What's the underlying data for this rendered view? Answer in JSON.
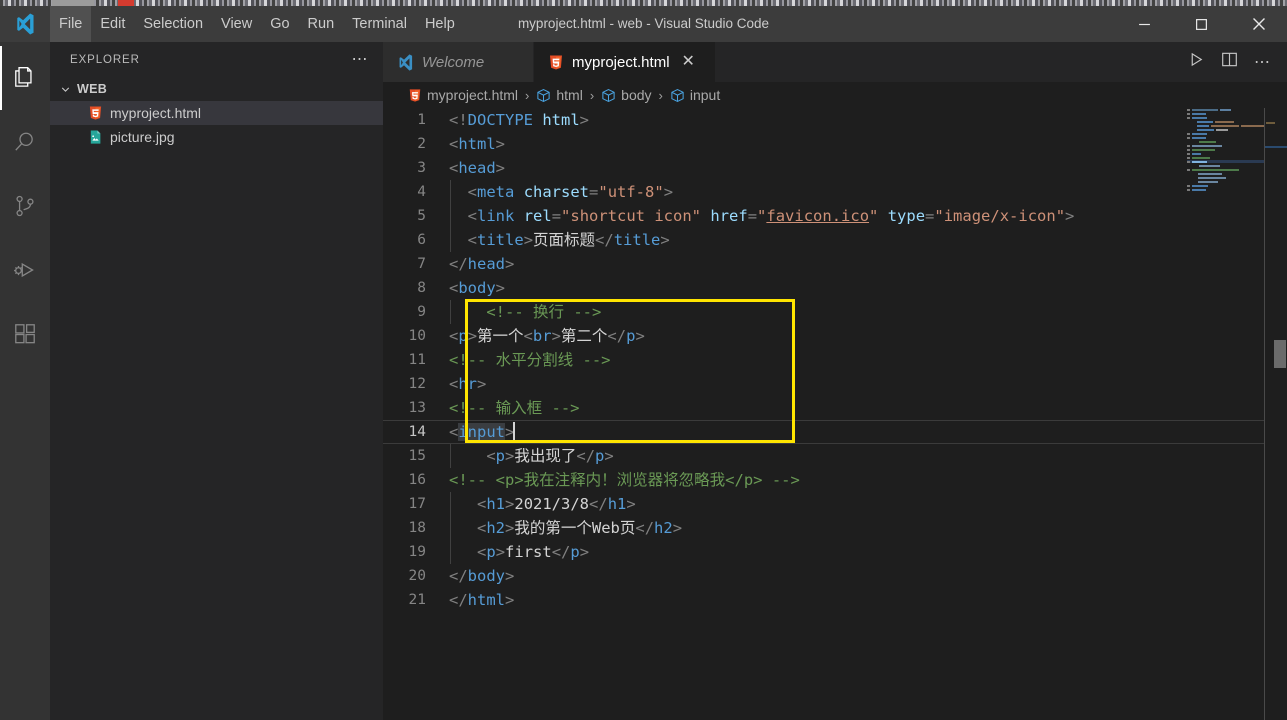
{
  "window": {
    "title": "myproject.html - web - Visual Studio Code",
    "controls": {
      "minimize": "─",
      "maximize": "□",
      "close": "✕"
    }
  },
  "menu": {
    "items": [
      {
        "label": "File",
        "active": true
      },
      {
        "label": "Edit",
        "active": false
      },
      {
        "label": "Selection",
        "active": false
      },
      {
        "label": "View",
        "active": false
      },
      {
        "label": "Go",
        "active": false
      },
      {
        "label": "Run",
        "active": false
      },
      {
        "label": "Terminal",
        "active": false
      },
      {
        "label": "Help",
        "active": false
      }
    ]
  },
  "activity_bar": {
    "items": [
      {
        "name": "explorer",
        "title": "Explorer",
        "active": true
      },
      {
        "name": "search",
        "title": "Search",
        "active": false
      },
      {
        "name": "source-control",
        "title": "Source Control",
        "active": false
      },
      {
        "name": "run-debug",
        "title": "Run and Debug",
        "active": false
      },
      {
        "name": "extensions",
        "title": "Extensions",
        "active": false
      }
    ]
  },
  "sidebar": {
    "title": "EXPLORER",
    "more_actions": "⋯",
    "folder": {
      "label": "WEB",
      "expanded": true
    },
    "files": [
      {
        "label": "myproject.html",
        "icon": "html5-file-icon",
        "selected": true
      },
      {
        "label": "picture.jpg",
        "icon": "image-file-icon",
        "selected": false
      }
    ]
  },
  "tabs": [
    {
      "label": "Welcome",
      "icon": "vscode-logo-icon",
      "active": false,
      "italic": true,
      "closable": false
    },
    {
      "label": "myproject.html",
      "icon": "html5-file-icon",
      "active": true,
      "italic": false,
      "closable": true,
      "close": "✕"
    }
  ],
  "editor_actions": [
    {
      "name": "run-file-button",
      "glyph": "▷"
    },
    {
      "name": "split-editor-button",
      "glyph": "split"
    },
    {
      "name": "more-actions-button",
      "glyph": "⋯"
    }
  ],
  "breadcrumbs": {
    "separator": "›",
    "items": [
      {
        "label": "myproject.html",
        "icon": "html5-file-icon"
      },
      {
        "label": "html",
        "icon": "symbol-cube-icon"
      },
      {
        "label": "body",
        "icon": "symbol-cube-icon"
      },
      {
        "label": "input",
        "icon": "symbol-cube-icon"
      }
    ]
  },
  "code": {
    "language": "html",
    "cursor_line": 14,
    "selection_text": "input",
    "line_numbers": [
      1,
      2,
      3,
      4,
      5,
      6,
      7,
      8,
      9,
      10,
      11,
      12,
      13,
      14,
      15,
      16,
      17,
      18,
      19,
      20,
      21
    ],
    "lines": [
      {
        "n": 1,
        "text": "<!DOCTYPE html>"
      },
      {
        "n": 2,
        "text": "<html>"
      },
      {
        "n": 3,
        "text": "<head>"
      },
      {
        "n": 4,
        "text": "  <meta charset=\"utf-8\">"
      },
      {
        "n": 5,
        "text": "  <link rel=\"shortcut icon\" href=\"favicon.ico\" type=\"image/x-icon\">"
      },
      {
        "n": 6,
        "text": "  <title>页面标题</title>"
      },
      {
        "n": 7,
        "text": "</head>"
      },
      {
        "n": 8,
        "text": "<body>"
      },
      {
        "n": 9,
        "text": "    <!-- 换行 -->"
      },
      {
        "n": 10,
        "text": "<p>第一个<br>第二个</p>"
      },
      {
        "n": 11,
        "text": "<!-- 水平分割线 -->"
      },
      {
        "n": 12,
        "text": "<hr>"
      },
      {
        "n": 13,
        "text": "<!-- 输入框 -->"
      },
      {
        "n": 14,
        "text": "<input>"
      },
      {
        "n": 15,
        "text": "    <p>我出现了</p>"
      },
      {
        "n": 16,
        "text": "<!-- <p>我在注释内！浏览器将忽略我</p> -->"
      },
      {
        "n": 17,
        "text": "   <h1>2021/3/8</h1>"
      },
      {
        "n": 18,
        "text": "   <h2>我的第一个Web页</h2>"
      },
      {
        "n": 19,
        "text": "   <p>first</p>"
      },
      {
        "n": 20,
        "text": "</body>"
      },
      {
        "n": 21,
        "text": "</html>"
      }
    ]
  },
  "annotation": {
    "highlight_box": {
      "color": "#ffe500",
      "covers_lines": "9-14"
    }
  },
  "theme": {
    "background": "#1e1e1e",
    "sidebar_bg": "#252526",
    "activitybar_bg": "#333333",
    "titlebar_bg": "#3c3c3c",
    "tag_color": "#569cd6",
    "attr_color": "#9cdcfe",
    "string_color": "#ce9178",
    "comment_color": "#6a9955",
    "text_color": "#d4d4d4",
    "linenumber_color": "#858585",
    "selection_color": "#3a3d41",
    "accent": "#007acc"
  }
}
